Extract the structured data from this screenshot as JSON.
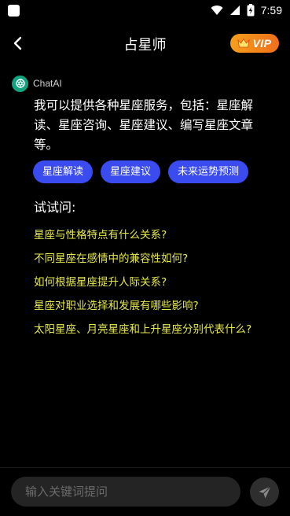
{
  "status_bar": {
    "time": "7:59",
    "icons": [
      "app-square-icon",
      "wifi-icon",
      "signal-icon",
      "battery-charging-icon"
    ]
  },
  "header": {
    "title": "占星师",
    "back_icon": "back-arrow-icon",
    "vip_label": "VIP",
    "vip_colors": [
      "#f59f1c",
      "#f06f1a"
    ]
  },
  "bot": {
    "name": "ChatAI",
    "avatar_color": "#10a37f"
  },
  "message": {
    "text": "我可以提供各种星座服务，包括：星座解读、星座咨询、星座建议、编写星座文章等。"
  },
  "chips": [
    {
      "label": "星座解读"
    },
    {
      "label": "星座建议"
    },
    {
      "label": "未来运势预测"
    }
  ],
  "try_label": "试试问:",
  "suggestions": [
    {
      "text": "星座与性格特点有什么关系?"
    },
    {
      "text": "不同星座在感情中的兼容性如何?"
    },
    {
      "text": "如何根据星座提升人际关系?"
    },
    {
      "text": "星座对职业选择和发展有哪些影响?"
    },
    {
      "text": "太阳星座、月亮星座和上升星座分别代表什么?"
    }
  ],
  "input": {
    "placeholder": "输入关键词提问",
    "value": ""
  },
  "colors": {
    "background": "#000000",
    "chip": "#3a4bf0",
    "suggestion_text": "#e6e94a",
    "input_bg": "#242424"
  }
}
